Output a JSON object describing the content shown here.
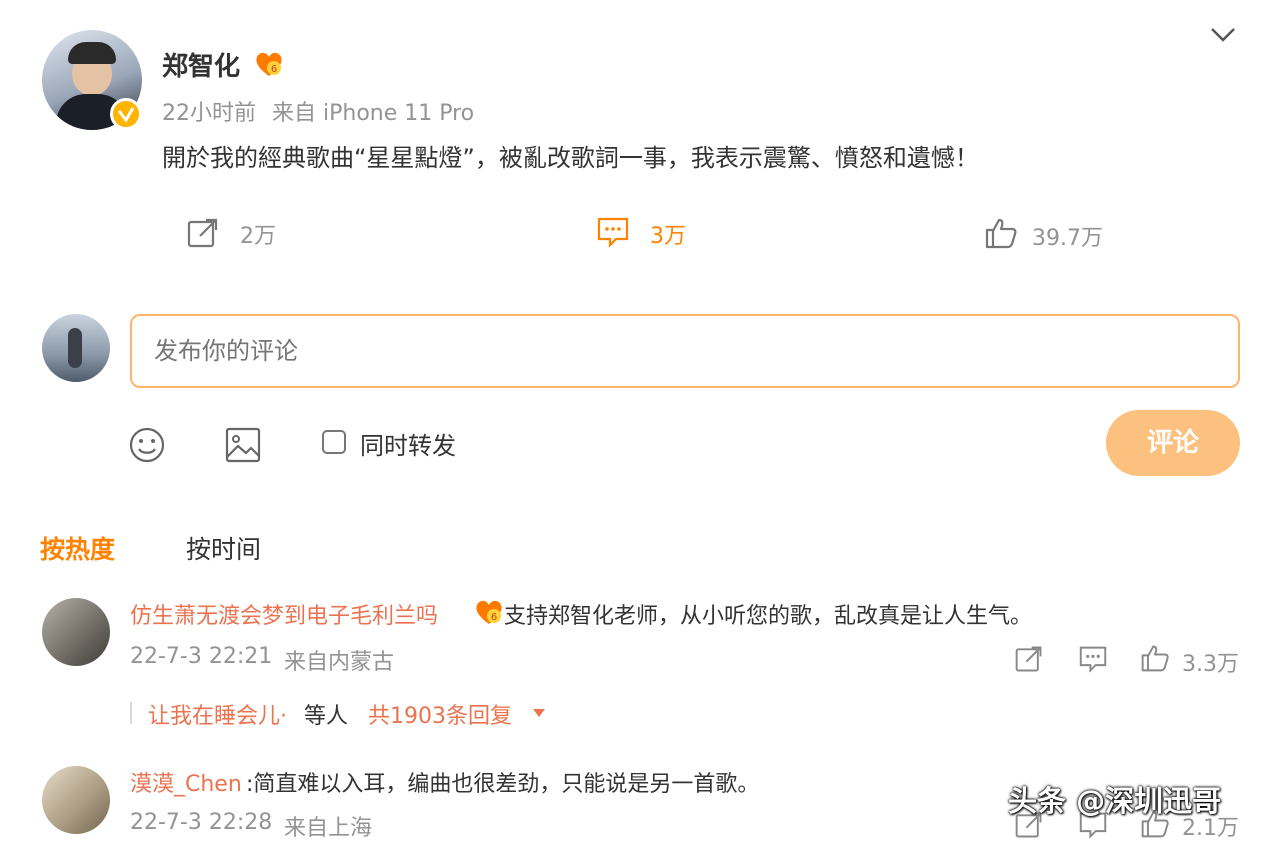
{
  "post": {
    "author": "郑智化",
    "time": "22小时前",
    "source": "来自 iPhone 11 Pro",
    "text": "開於我的經典歌曲“星星點燈”，被亂改歌詞一事，我表示震驚、憤怒和遺憾！",
    "repost_count": "2万",
    "comment_count": "3万",
    "like_count": "39.7万"
  },
  "composer": {
    "placeholder": "发布你的评论",
    "also_repost_label": "同时转发",
    "submit_label": "评论"
  },
  "sort": {
    "by_heat": "按热度",
    "by_time": "按时间"
  },
  "comments": [
    {
      "user": "仿生萧无渡会梦到电子毛利兰吗",
      "text": "支持郑智化老师，从小听您的歌，乱改真是让人生气。",
      "time": "22-7-3 22:21",
      "source": "来自内蒙古",
      "likes": "3.3万",
      "reply_user": "让我在睡会儿·",
      "reply_others": "等人",
      "reply_count": "共1903条回复"
    },
    {
      "user": "漠漠_Chen",
      "text": ":简直难以入耳，编曲也很差劲，只能说是另一首歌。",
      "time": "22-7-3 22:28",
      "source": "来自上海",
      "likes": "2.1万"
    }
  ],
  "watermark": "头条 @深圳迅哥",
  "colors": {
    "accent": "#ff8200",
    "username": "#eb7350",
    "submit_bg": "#fcc07f",
    "input_border": "#ffb36b"
  }
}
